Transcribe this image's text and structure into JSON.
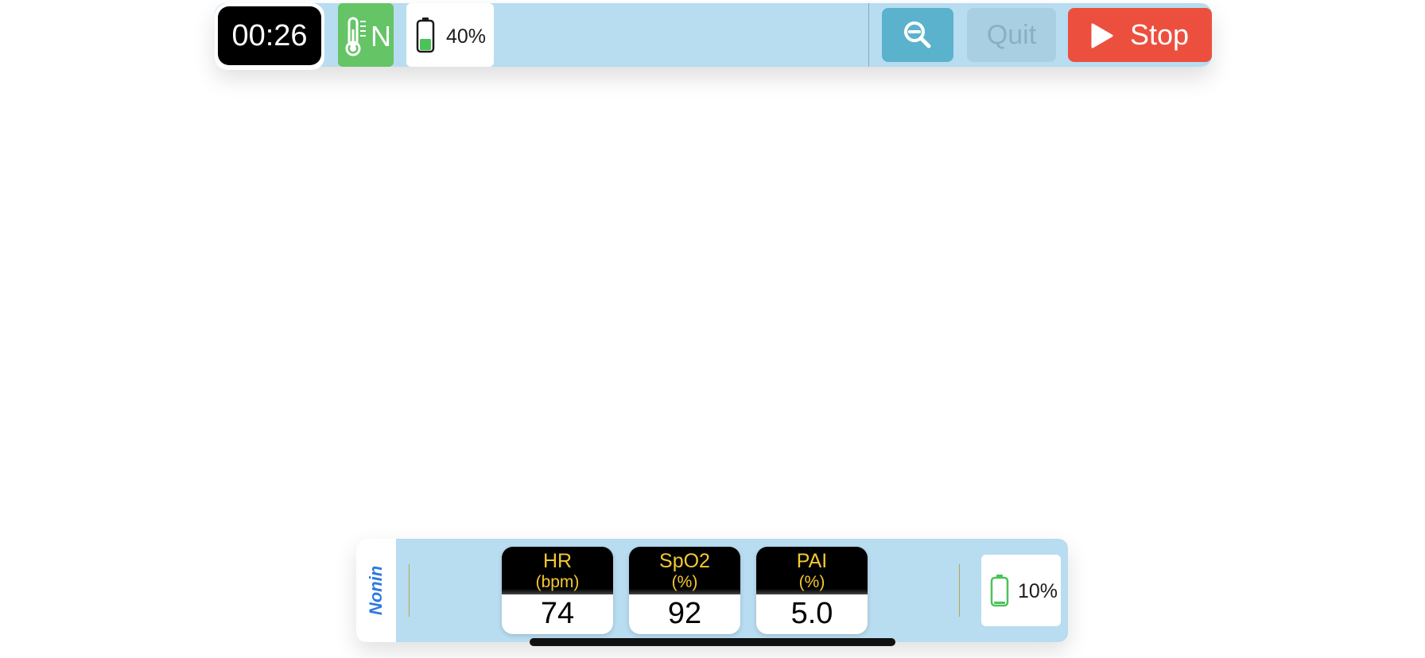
{
  "toolbar": {
    "timer": "00:26",
    "temperature_mode": "N",
    "temperature_icon": "thermometer-icon",
    "phone_battery_level": "40%",
    "phone_battery_fill": 0.4,
    "zoom_icon": "zoom-out-icon",
    "quit_label": "Quit",
    "stop_label": "Stop",
    "stop_icon": "play-icon"
  },
  "device": {
    "name": "Nonin",
    "battery_level": "10%",
    "battery_fill": 0.1,
    "metrics": [
      {
        "name": "HR",
        "unit": "(bpm)",
        "value": "74"
      },
      {
        "name": "SpO2",
        "unit": "(%)",
        "value": "92"
      },
      {
        "name": "PAI",
        "unit": "(%)",
        "value": "5.0"
      }
    ]
  },
  "colors": {
    "bar_background": "#b8dcf0",
    "temperature_tile": "#64c466",
    "zoom_button": "#5ab2cc",
    "quit_button_disabled": "#a9cfe2",
    "stop_button": "#ed4f3e",
    "metric_label": "#f5c832",
    "device_label": "#2d79e0",
    "battery_fill": "#4cc25a"
  }
}
